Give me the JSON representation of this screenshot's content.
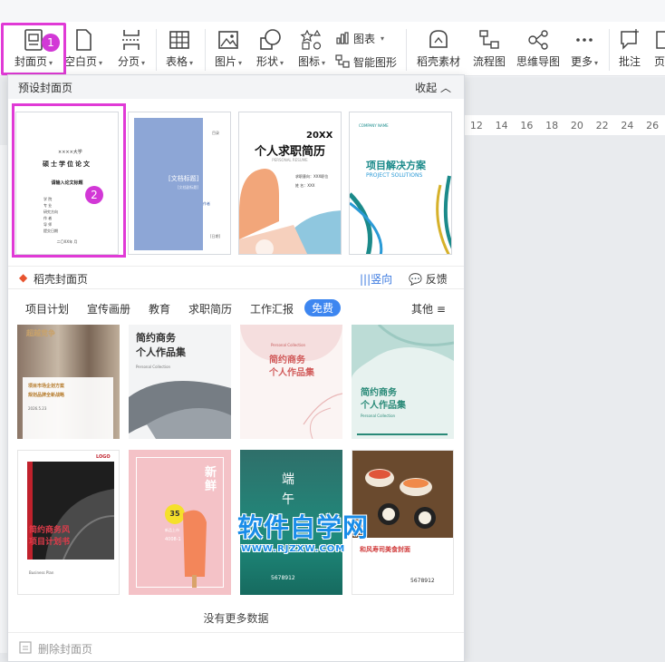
{
  "ribbon": {
    "cover_page": "封面页",
    "blank_page": "空白页",
    "page_break": "分页",
    "table": "表格",
    "picture": "图片",
    "shape": "形状",
    "icon": "图标",
    "chart": "图表",
    "smart_art": "智能图形",
    "docer_material": "稻壳素材",
    "flowchart": "流程图",
    "mindmap": "思维导图",
    "more": "更多",
    "comment": "批注",
    "page_cut": "页"
  },
  "badges": {
    "one": "1",
    "two": "2"
  },
  "ruler_numbers": [
    "12",
    "14",
    "16",
    "18",
    "20",
    "22",
    "24",
    "26"
  ],
  "panel": {
    "title": "预设封面页",
    "collapse": "收起",
    "presets": [
      {
        "university": "××××大学",
        "title": "硕士学位论文",
        "subtitle": "请输入论文标题",
        "date": "二〇XX年 月",
        "fields": [
          "学  院",
          "专  业",
          "研究方向",
          "作  者",
          "导  师",
          "提交日期"
        ]
      },
      {
        "top": "目录",
        "title": "[文档标题]",
        "subtitle": "[文档副标题]",
        "author": "作者",
        "date": "[日期]"
      },
      {
        "year": "20XX",
        "title": "个人求职简历",
        "en": "PERSONAL RESUME",
        "line1": "求职意向：XXX职位",
        "line2": "姓    名：XXX"
      },
      {
        "company": "COMPANY NAME",
        "title": "项目解决方案",
        "en": "PROJECT SOLUTIONS"
      }
    ],
    "docer_section": "稻壳封面页",
    "vertical": "竖向",
    "feedback": "反馈",
    "categories": [
      "项目计划",
      "宣传画册",
      "教育",
      "求职简历",
      "工作汇报",
      "免费"
    ],
    "other": "其他",
    "templates": [
      {
        "label": "超越竞争",
        "title": "项目市场企划方案",
        "sub": "规划品牌全新战略",
        "date": "2026.5.23"
      },
      {
        "title": "简约商务",
        "title2": "个人作品集",
        "sub": "Personal Collection"
      },
      {
        "en": "Personal Collection",
        "title": "简约商务",
        "title2": "个人作品集"
      },
      {
        "title": "简约商务",
        "title2": "个人作品集",
        "sub": "Personal Collection"
      },
      {
        "brand": "LOGO",
        "title": "简约商务风",
        "title2": "项目计划书",
        "sub": "Business Plan"
      },
      {
        "big": "新鲜",
        "num": "35",
        "badge": "新品上市",
        "phone": "4008-1"
      },
      {
        "word1": "端",
        "word2": "午",
        "phone": "5678912"
      },
      {
        "title": "和风寿司美食封面",
        "phone": "5678912"
      }
    ],
    "no_more": "没有更多数据",
    "delete_cover": "删除封面页"
  },
  "watermark": {
    "big": "软件自学网",
    "small": "WWW.RJZXW.COM"
  }
}
